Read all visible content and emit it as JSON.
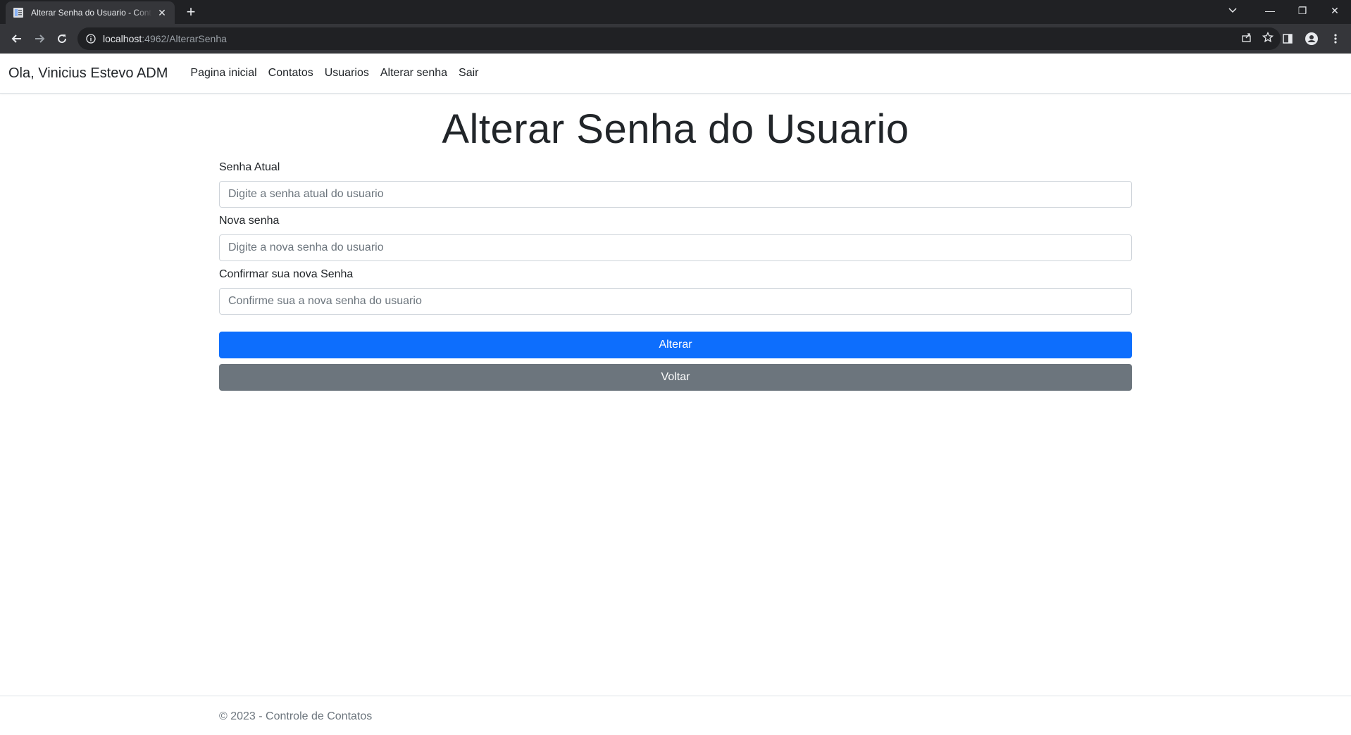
{
  "browser": {
    "tab_title": "Alterar Senha do Usuario - Controle de Contatos",
    "tab_close": "✕",
    "new_tab": "+",
    "url_host": "localhost",
    "url_rest": ":4962/AlterarSenha",
    "window_controls": {
      "minimize": "—",
      "restore": "❐",
      "close": "✕"
    }
  },
  "navbar": {
    "brand": "Ola, Vinicius Estevo ADM",
    "links": [
      "Pagina inicial",
      "Contatos",
      "Usuarios",
      "Alterar senha",
      "Sair"
    ]
  },
  "page": {
    "title": "Alterar Senha do Usuario",
    "fields": [
      {
        "label": "Senha Atual",
        "placeholder": "Digite a senha atual do usuario",
        "value": ""
      },
      {
        "label": "Nova senha",
        "placeholder": "Digite a nova senha do usuario",
        "value": ""
      },
      {
        "label": "Confirmar sua nova Senha",
        "placeholder": "Confirme sua a nova senha do usuario",
        "value": ""
      }
    ],
    "submit_label": "Alterar",
    "back_label": "Voltar"
  },
  "footer": {
    "text": "© 2023 - Controle de Contatos"
  },
  "colors": {
    "primary": "#0d6efd",
    "secondary": "#6c757d",
    "browser_dark": "#202124",
    "browser_toolbar": "#35363a"
  }
}
